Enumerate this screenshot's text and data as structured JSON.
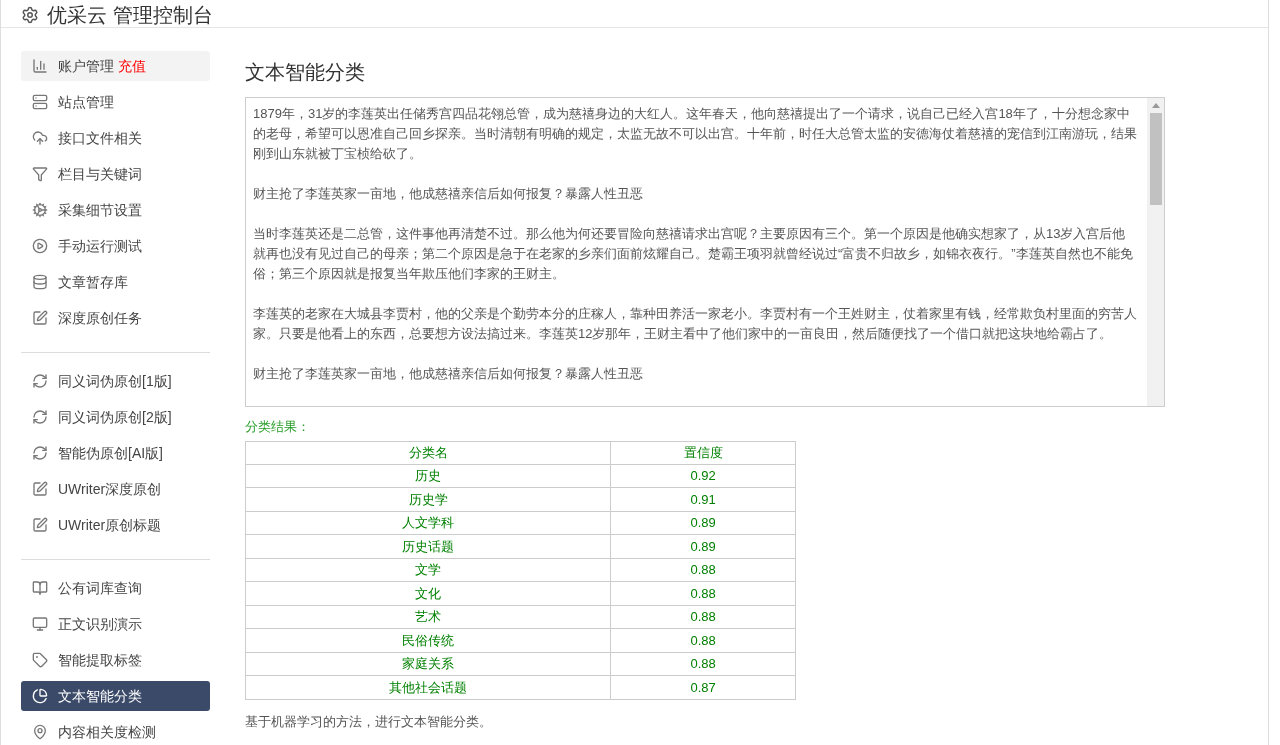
{
  "header": {
    "title": "优采云 管理控制台"
  },
  "sidebar": {
    "groups": [
      {
        "items": [
          {
            "label": "账户管理",
            "badge": "充值",
            "hovered": true,
            "selected": false
          },
          {
            "label": "站点管理",
            "hovered": false,
            "selected": false
          },
          {
            "label": "接口文件相关",
            "hovered": false,
            "selected": false
          },
          {
            "label": "栏目与关键词",
            "hovered": false,
            "selected": false
          },
          {
            "label": "采集细节设置",
            "hovered": false,
            "selected": false
          },
          {
            "label": "手动运行测试",
            "hovered": false,
            "selected": false
          },
          {
            "label": "文章暂存库",
            "hovered": false,
            "selected": false
          },
          {
            "label": "深度原创任务",
            "hovered": false,
            "selected": false
          }
        ]
      },
      {
        "items": [
          {
            "label": "同义词伪原创[1版]",
            "hovered": false,
            "selected": false
          },
          {
            "label": "同义词伪原创[2版]",
            "hovered": false,
            "selected": false
          },
          {
            "label": "智能伪原创[AI版]",
            "hovered": false,
            "selected": false
          },
          {
            "label": "UWriter深度原创",
            "hovered": false,
            "selected": false
          },
          {
            "label": "UWriter原创标题",
            "hovered": false,
            "selected": false
          }
        ]
      },
      {
        "items": [
          {
            "label": "公有词库查询",
            "hovered": false,
            "selected": false
          },
          {
            "label": "正文识别演示",
            "hovered": false,
            "selected": false
          },
          {
            "label": "智能提取标签",
            "hovered": false,
            "selected": false
          },
          {
            "label": "文本智能分类",
            "hovered": false,
            "selected": true
          },
          {
            "label": "内容相关度检测",
            "hovered": false,
            "selected": false
          }
        ]
      }
    ]
  },
  "main": {
    "title": "文本智能分类",
    "text_area": {
      "value": [
        "1879年，31岁的李莲英出任储秀宫四品花翎总管，成为慈禧身边的大红人。这年春天，他向慈禧提出了一个请求，说自己已经入宫18年了，十分想念家中的老母，希望可以恩准自己回乡探亲。当时清朝有明确的规定，太监无故不可以出宫。十年前，时任大总管太监的安德海仗着慈禧的宠信到江南游玩，结果刚到山东就被丁宝桢给砍了。",
        "财主抢了李莲英家一亩地，他成慈禧亲信后如何报复？暴露人性丑恶",
        "当时李莲英还是二总管，这件事他再清楚不过。那么他为何还要冒险向慈禧请求出宫呢？主要原因有三个。第一个原因是他确实想家了，从13岁入宫后他就再也没有见过自己的母亲；第二个原因是急于在老家的乡亲们面前炫耀自己。楚霸王项羽就曾经说过“富贵不归故乡，如锦衣夜行。”李莲英自然也不能免俗；第三个原因就是报复当年欺压他们李家的王财主。",
        "李莲英的老家在大城县李贾村，他的父亲是个勤劳本分的庄稼人，靠种田养活一家老小。李贾村有一个王姓财主，仗着家里有钱，经常欺负村里面的穷苦人家。只要是他看上的东西，总要想方设法搞过来。李莲英12岁那年，王财主看中了他们家中的一亩良田，然后随便找了一个借口就把这块地给霸占了。",
        "财主抢了李莲英家一亩地，他成慈禧亲信后如何报复？暴露人性丑恶"
      ]
    },
    "result_label": "分类结果：",
    "table": {
      "columns": [
        "分类名",
        "置信度"
      ],
      "rows": [
        [
          "历史",
          "0.92"
        ],
        [
          "历史学",
          "0.91"
        ],
        [
          "人文学科",
          "0.89"
        ],
        [
          "历史话题",
          "0.89"
        ],
        [
          "文学",
          "0.88"
        ],
        [
          "文化",
          "0.88"
        ],
        [
          "艺术",
          "0.88"
        ],
        [
          "民俗传统",
          "0.88"
        ],
        [
          "家庭关系",
          "0.88"
        ],
        [
          "其他社会话题",
          "0.87"
        ]
      ]
    },
    "note": "基于机器学习的方法，进行文本智能分类。"
  }
}
